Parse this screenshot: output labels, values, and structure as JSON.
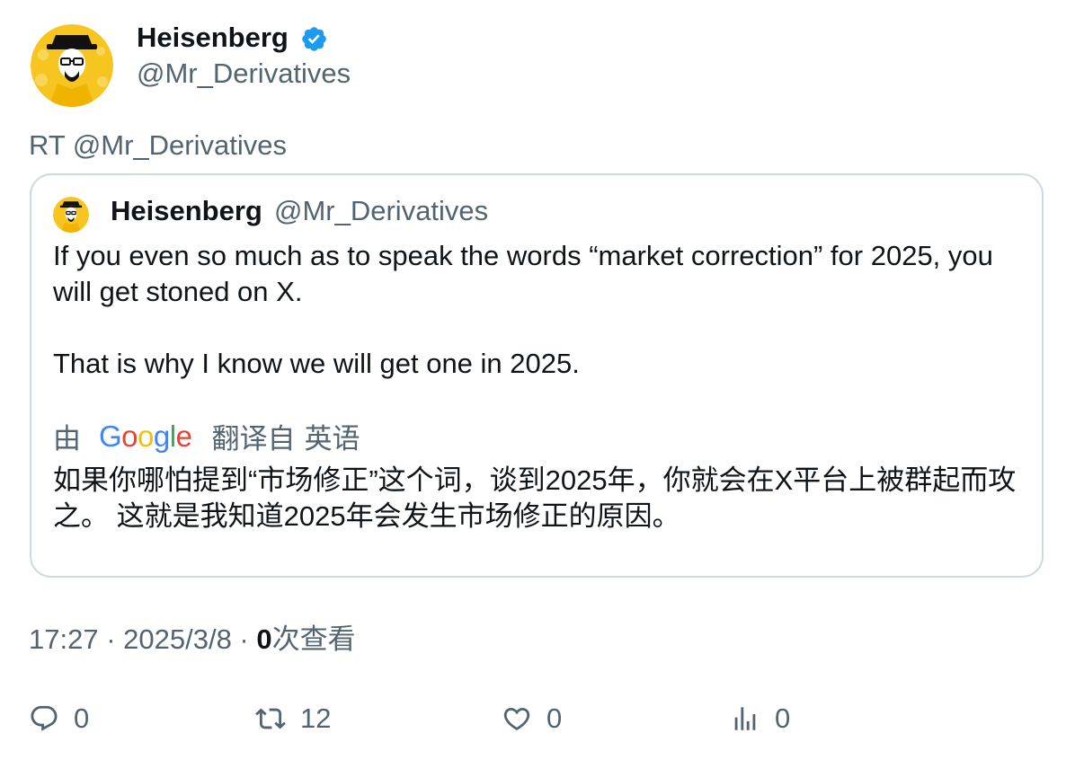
{
  "author": {
    "name": "Heisenberg",
    "handle": "@Mr_Derivatives",
    "verified_color": "#1d9bf0"
  },
  "retweet_line": "RT @Mr_Derivatives",
  "quoted_tweet": {
    "name": "Heisenberg",
    "handle": "@Mr_Derivatives",
    "text_line1": "If you even so much as to speak the words “market correction” for 2025, you will get stoned on X.",
    "text_line2": "That is why I know we will get one in 2025.",
    "translate_prefix": "由",
    "translate_logo": "Google",
    "translate_suffix_1": "翻译自",
    "translate_suffix_2": "英语",
    "translation": "如果你哪怕提到“市场修正”这个词，谈到2025年，你就会在X平台上被群起而攻之。 这就是我知道2025年会发生市场修正的原因。"
  },
  "meta": {
    "time": "17:27",
    "sep1": " · ",
    "date": "2025/3/8",
    "sep2": " · ",
    "views_count": "0",
    "views_label": "次查看"
  },
  "actions": {
    "reply_icon": "reply-icon",
    "reply_count": "0",
    "retweet_icon": "retweet-icon",
    "retweet_count": "12",
    "like_icon": "like-icon",
    "like_count": "0",
    "views_icon": "analytics-icon",
    "views_count": "0"
  },
  "colors": {
    "primary_text": "#0f1419",
    "secondary_text": "#536471",
    "border": "#cfd9de",
    "avatar_bg": "#f5c518"
  }
}
